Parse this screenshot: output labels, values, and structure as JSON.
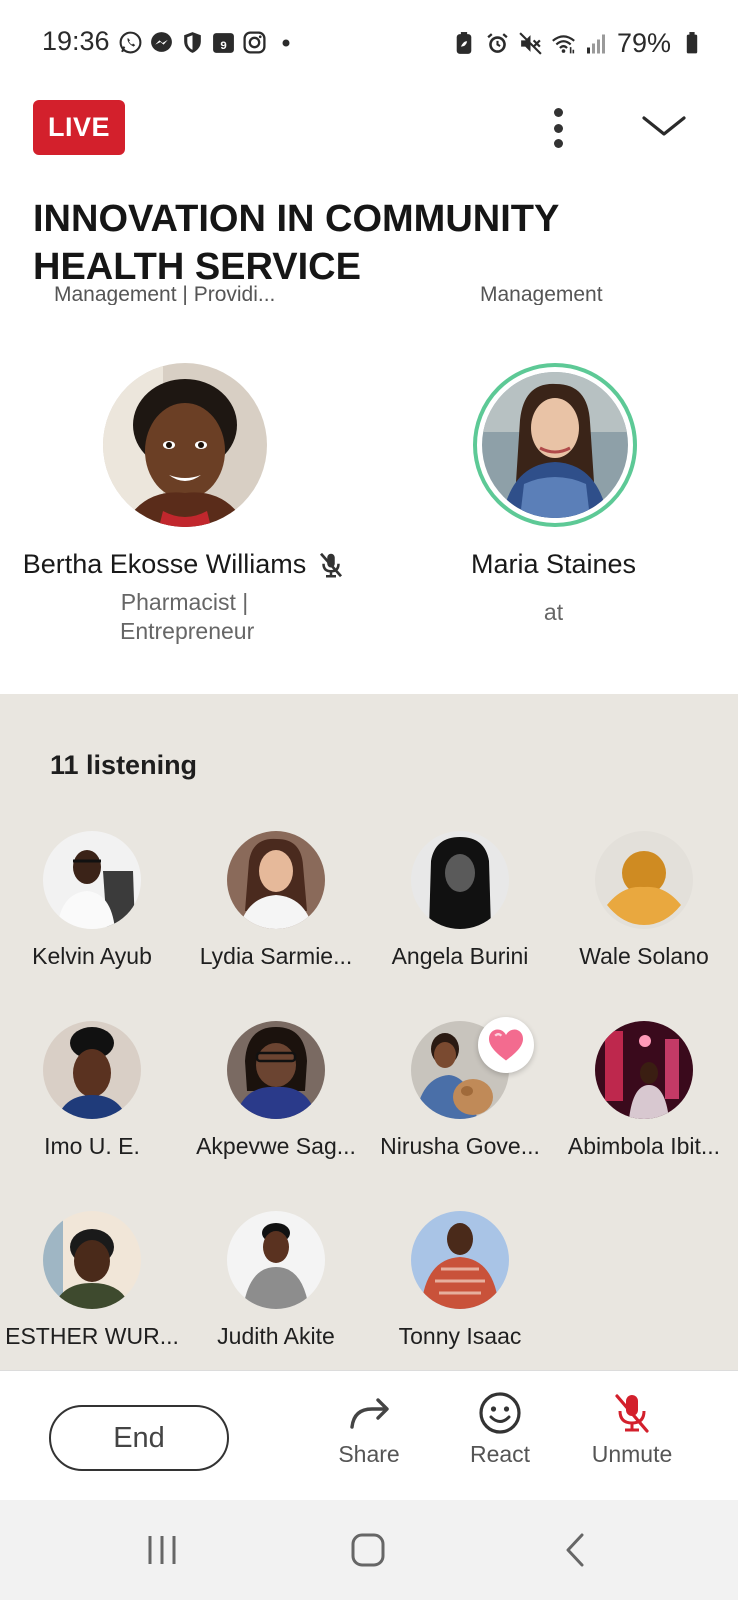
{
  "status_bar": {
    "time": "19:36",
    "battery": "79%",
    "left_icons": [
      "whatsapp-icon",
      "messenger-icon",
      "shield-icon",
      "calendar-icon",
      "instagram-icon",
      "dot-icon"
    ],
    "calendar_day": "9",
    "right_icons": [
      "battery-saver-icon",
      "alarm-icon",
      "mute-icon",
      "wifi-icon",
      "signal-icon",
      "battery-icon"
    ]
  },
  "header": {
    "live_label": "LIVE",
    "title": "INNOVATION IN COMMUNITY HEALTH SERVICE",
    "partial_subtitle_left": "Management  | Providi...",
    "partial_subtitle_right": "Management"
  },
  "speakers": [
    {
      "name": "Bertha Ekosse Williams",
      "role": "Pharmacist | Entrepreneur",
      "muted": true
    },
    {
      "name": "Maria Staines",
      "role": "at",
      "muted": false,
      "speaking": true
    }
  ],
  "listeners": {
    "count_label": "11 listening",
    "people": [
      {
        "name": "Kelvin Ayub"
      },
      {
        "name": "Lydia Sarmie..."
      },
      {
        "name": "Angela Burini"
      },
      {
        "name": "Wale Solano"
      },
      {
        "name": "Imo U. E."
      },
      {
        "name": "Akpevwe Sag..."
      },
      {
        "name": "Nirusha Gove...",
        "reaction": "heart"
      },
      {
        "name": "Abimbola Ibit..."
      },
      {
        "name": "ESTHER WUR..."
      },
      {
        "name": "Judith Akite"
      },
      {
        "name": "Tonny Isaac"
      }
    ]
  },
  "actions": {
    "end": "End",
    "share": "Share",
    "react": "React",
    "unmute": "Unmute"
  },
  "colors": {
    "live": "#d3202c",
    "speaking_ring": "#5dc996",
    "listeners_bg": "#e9e6e0",
    "unmute_icon": "#d3202c",
    "placeholder_avatar": "#e4a33a"
  }
}
